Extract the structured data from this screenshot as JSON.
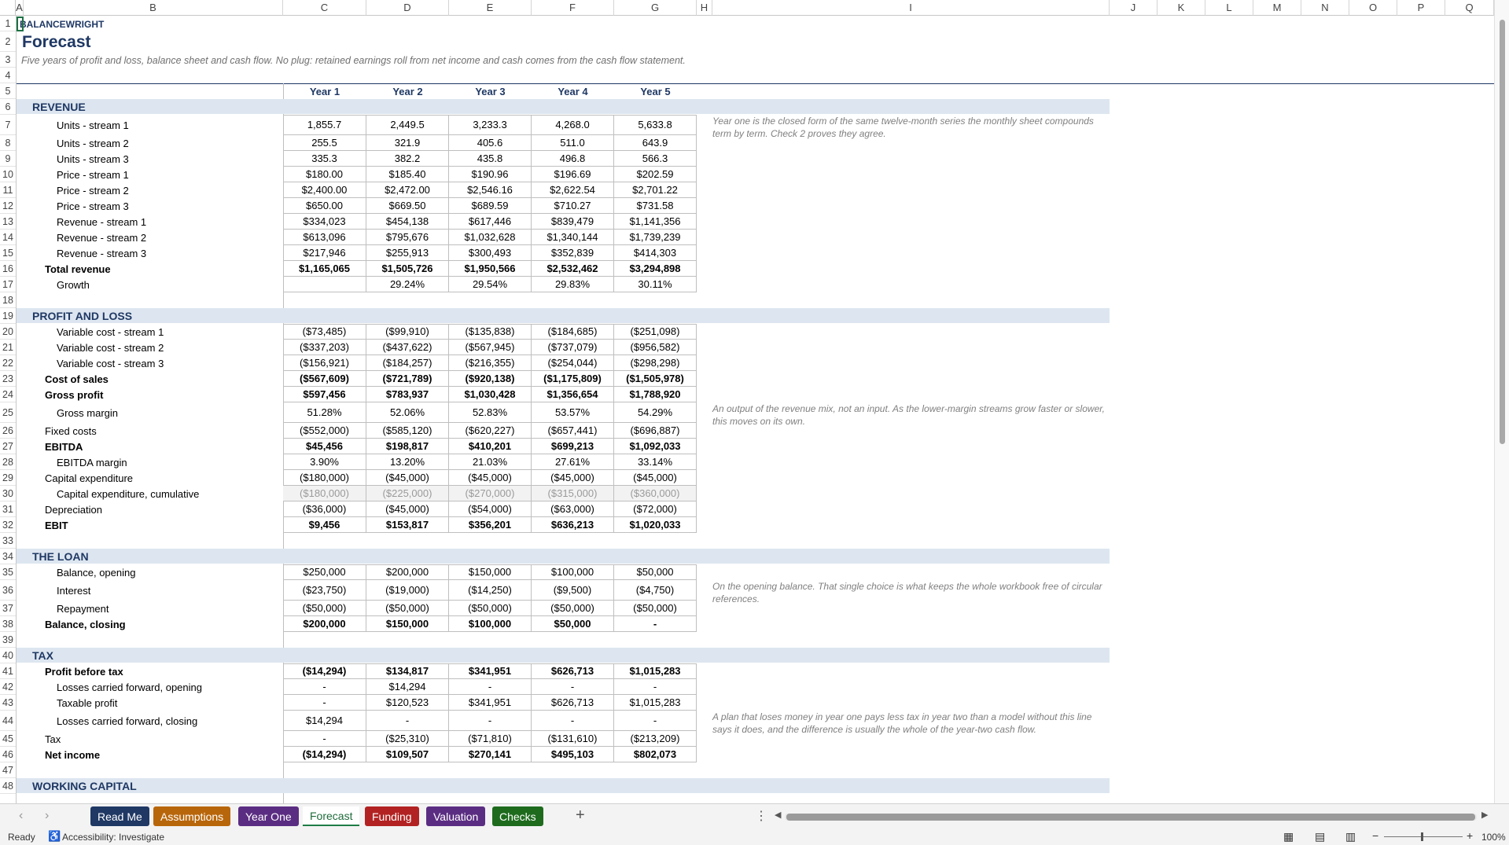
{
  "columns": [
    "A",
    "B",
    "C",
    "D",
    "E",
    "F",
    "G",
    "H",
    "I",
    "J",
    "K",
    "L",
    "M",
    "N",
    "O",
    "P",
    "Q"
  ],
  "title": {
    "brand": "BALANCEWRIGHT",
    "heading": "Forecast",
    "subtitle": "Five years of profit and loss, balance sheet and cash flow. No plug: retained earnings roll from net income and cash comes from the cash flow statement."
  },
  "years": [
    "Year 1",
    "Year 2",
    "Year 3",
    "Year 4",
    "Year 5"
  ],
  "sections": {
    "revenue": "REVENUE",
    "pnl": "PROFIT AND LOSS",
    "loan": "THE LOAN",
    "tax": "TAX",
    "next": "WORKING CAPITAL"
  },
  "rows": {
    "r7": {
      "label": "Units - stream 1",
      "vals": [
        "1,855.7",
        "2,449.5",
        "3,233.3",
        "4,268.0",
        "5,633.8"
      ]
    },
    "r8": {
      "label": "Units - stream 2",
      "vals": [
        "255.5",
        "321.9",
        "405.6",
        "511.0",
        "643.9"
      ]
    },
    "r9": {
      "label": "Units - stream 3",
      "vals": [
        "335.3",
        "382.2",
        "435.8",
        "496.8",
        "566.3"
      ]
    },
    "r10": {
      "label": "Price - stream 1",
      "vals": [
        "$180.00",
        "$185.40",
        "$190.96",
        "$196.69",
        "$202.59"
      ]
    },
    "r11": {
      "label": "Price - stream 2",
      "vals": [
        "$2,400.00",
        "$2,472.00",
        "$2,546.16",
        "$2,622.54",
        "$2,701.22"
      ]
    },
    "r12": {
      "label": "Price - stream 3",
      "vals": [
        "$650.00",
        "$669.50",
        "$689.59",
        "$710.27",
        "$731.58"
      ]
    },
    "r13": {
      "label": "Revenue - stream 1",
      "vals": [
        "$334,023",
        "$454,138",
        "$617,446",
        "$839,479",
        "$1,141,356"
      ]
    },
    "r14": {
      "label": "Revenue - stream 2",
      "vals": [
        "$613,096",
        "$795,676",
        "$1,032,628",
        "$1,340,144",
        "$1,739,239"
      ]
    },
    "r15": {
      "label": "Revenue - stream 3",
      "vals": [
        "$217,946",
        "$255,913",
        "$300,493",
        "$352,839",
        "$414,303"
      ]
    },
    "r16": {
      "label": "Total revenue",
      "vals": [
        "$1,165,065",
        "$1,505,726",
        "$1,950,566",
        "$2,532,462",
        "$3,294,898"
      ]
    },
    "r17": {
      "label": "Growth",
      "vals": [
        "",
        "29.24%",
        "29.54%",
        "29.83%",
        "30.11%"
      ]
    },
    "r20": {
      "label": "Variable cost - stream 1",
      "vals": [
        "($73,485)",
        "($99,910)",
        "($135,838)",
        "($184,685)",
        "($251,098)"
      ]
    },
    "r21": {
      "label": "Variable cost - stream 2",
      "vals": [
        "($337,203)",
        "($437,622)",
        "($567,945)",
        "($737,079)",
        "($956,582)"
      ]
    },
    "r22": {
      "label": "Variable cost - stream 3",
      "vals": [
        "($156,921)",
        "($184,257)",
        "($216,355)",
        "($254,044)",
        "($298,298)"
      ]
    },
    "r23": {
      "label": "Cost of sales",
      "vals": [
        "($567,609)",
        "($721,789)",
        "($920,138)",
        "($1,175,809)",
        "($1,505,978)"
      ]
    },
    "r24": {
      "label": "Gross profit",
      "vals": [
        "$597,456",
        "$783,937",
        "$1,030,428",
        "$1,356,654",
        "$1,788,920"
      ]
    },
    "r25": {
      "label": "Gross margin",
      "vals": [
        "51.28%",
        "52.06%",
        "52.83%",
        "53.57%",
        "54.29%"
      ]
    },
    "r26": {
      "label": "Fixed costs",
      "vals": [
        "($552,000)",
        "($585,120)",
        "($620,227)",
        "($657,441)",
        "($696,887)"
      ]
    },
    "r27": {
      "label": "EBITDA",
      "vals": [
        "$45,456",
        "$198,817",
        "$410,201",
        "$699,213",
        "$1,092,033"
      ]
    },
    "r28": {
      "label": "EBITDA margin",
      "vals": [
        "3.90%",
        "13.20%",
        "21.03%",
        "27.61%",
        "33.14%"
      ]
    },
    "r29": {
      "label": "Capital expenditure",
      "vals": [
        "($180,000)",
        "($45,000)",
        "($45,000)",
        "($45,000)",
        "($45,000)"
      ]
    },
    "r30": {
      "label": "Capital expenditure, cumulative",
      "vals": [
        "($180,000)",
        "($225,000)",
        "($270,000)",
        "($315,000)",
        "($360,000)"
      ]
    },
    "r31": {
      "label": "Depreciation",
      "vals": [
        "($36,000)",
        "($45,000)",
        "($54,000)",
        "($63,000)",
        "($72,000)"
      ]
    },
    "r32": {
      "label": "EBIT",
      "vals": [
        "$9,456",
        "$153,817",
        "$356,201",
        "$636,213",
        "$1,020,033"
      ]
    },
    "r35": {
      "label": "Balance, opening",
      "vals": [
        "$250,000",
        "$200,000",
        "$150,000",
        "$100,000",
        "$50,000"
      ]
    },
    "r36": {
      "label": "Interest",
      "vals": [
        "($23,750)",
        "($19,000)",
        "($14,250)",
        "($9,500)",
        "($4,750)"
      ]
    },
    "r37": {
      "label": "Repayment",
      "vals": [
        "($50,000)",
        "($50,000)",
        "($50,000)",
        "($50,000)",
        "($50,000)"
      ]
    },
    "r38": {
      "label": "Balance, closing",
      "vals": [
        "$200,000",
        "$150,000",
        "$100,000",
        "$50,000",
        "-"
      ]
    },
    "r41": {
      "label": "Profit before tax",
      "vals": [
        "($14,294)",
        "$134,817",
        "$341,951",
        "$626,713",
        "$1,015,283"
      ]
    },
    "r42": {
      "label": "Losses carried forward, opening",
      "vals": [
        "-",
        "$14,294",
        "-",
        "-",
        "-"
      ]
    },
    "r43": {
      "label": "Taxable profit",
      "vals": [
        "-",
        "$120,523",
        "$341,951",
        "$626,713",
        "$1,015,283"
      ]
    },
    "r44": {
      "label": "Losses carried forward, closing",
      "vals": [
        "$14,294",
        "-",
        "-",
        "-",
        "-"
      ]
    },
    "r45": {
      "label": "Tax",
      "vals": [
        "-",
        "($25,310)",
        "($71,810)",
        "($131,610)",
        "($213,209)"
      ]
    },
    "r46": {
      "label": "Net income",
      "vals": [
        "($14,294)",
        "$109,507",
        "$270,141",
        "$495,103",
        "$802,073"
      ]
    }
  },
  "notes": {
    "n7": "Year one is the closed form of the same twelve-month series the monthly sheet compounds term by term. Check 2 proves they agree.",
    "n25": "An output of the revenue mix, not an input. As the lower-margin streams grow faster or slower, this moves on its own.",
    "n36": "On the opening balance. That single choice is what keeps the whole workbook free of circular references.",
    "n44": "A plan that loses money in year one pays less tax in year two than a model without this line says it does, and the difference is usually the whole of the year-two cash flow."
  },
  "tabs": [
    {
      "label": "Read Me",
      "color": "#1f3864"
    },
    {
      "label": "Assumptions",
      "color": "#b8660b"
    },
    {
      "label": "Year One",
      "color": "#5b2d82"
    },
    {
      "label": "Forecast",
      "color": "#ffffff"
    },
    {
      "label": "Funding",
      "color": "#b22222"
    },
    {
      "label": "Valuation",
      "color": "#5b2d82"
    },
    {
      "label": "Checks",
      "color": "#1e6b1e"
    }
  ],
  "status": {
    "ready": "Ready",
    "accessibility": "Accessibility: Investigate",
    "zoom": "100%"
  },
  "icons": [
    "prev-sheet-icon",
    "next-sheet-icon",
    "add-sheet-icon",
    "more-options-icon",
    "normal-view-icon",
    "page-layout-icon",
    "page-break-icon",
    "zoom-out-icon",
    "zoom-in-icon"
  ]
}
